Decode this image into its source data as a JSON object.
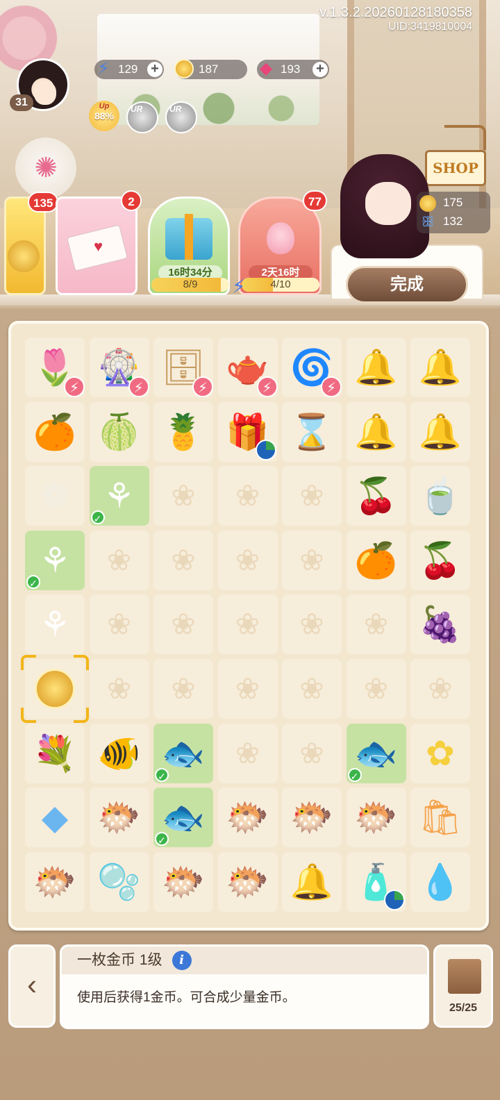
{
  "header": {
    "version": "v.1.3.2.20260128180358",
    "uid": "UID:3419810004",
    "level": "31"
  },
  "resources": {
    "energy": "129",
    "coins": "187",
    "gems": "193"
  },
  "badges": {
    "up_label": "Up",
    "up_percent": "88%",
    "ur_1": "UR",
    "ur_2": "UR"
  },
  "cards": {
    "gold_badge": "135",
    "mail_badge": "2",
    "gift_time": "16时34分",
    "gift_progress": "8/9",
    "gift_progress_fraction": 0.889,
    "peach_badge": "77",
    "peach_time": "2天16时",
    "peach_progress": "4/10",
    "peach_progress_fraction": 0.4
  },
  "shop": {
    "sign": "SHOP",
    "coins": "175",
    "butterflies": "132",
    "done_button": "完成"
  },
  "board": {
    "rows": [
      [
        "flower-planter-icon",
        "mill-garden-icon",
        "shelf-icon",
        "teapot-icon",
        "galaxy-orb-icon",
        "dome-white-flower-icon",
        "dome-lavender-icon"
      ],
      [
        "orange-fruit-icon",
        "green-fruit-icon",
        "pineapple-icon",
        "gift-box-icon",
        "hourglass-icon",
        "dome-purple-star-icon",
        "dome-purple-star-icon"
      ],
      [
        "gardenia-icon",
        "lily-icon",
        "",
        "",
        "",
        "berry-branch-icon",
        "tea-cup-icon"
      ],
      [
        "lily-icon",
        "",
        "",
        "",
        "",
        "kumquat-icon",
        "cherry-icon"
      ],
      [
        "calla-lily-icon",
        "",
        "",
        "",
        "",
        "",
        "green-grapes-icon"
      ],
      [
        "gold-coin-icon",
        "",
        "",
        "",
        "",
        "",
        ""
      ],
      [
        "calla-bouquet-icon",
        "betta-fish-icon",
        "clownfish-icon",
        "",
        "",
        "clownfish-icon",
        "yellow-flower-icon"
      ],
      [
        "blue-crystal-icon",
        "goldfish-icon",
        "clownfish-icon",
        "goldfish-icon",
        "goldfish-icon",
        "goldfish-icon",
        "orange-bag-icon"
      ],
      [
        "goldfish-icon",
        "fishbowl-icon",
        "goldfish-icon",
        "goldfish-icon",
        "dome-vanilla-icon",
        "perfume-bottle-icon",
        "pink-slime-icon"
      ]
    ],
    "green_cells": [
      [
        2,
        1
      ],
      [
        3,
        0
      ],
      [
        6,
        2
      ],
      [
        6,
        5
      ],
      [
        7,
        2
      ]
    ],
    "bolt_cells": [
      [
        0,
        0
      ],
      [
        0,
        1
      ],
      [
        0,
        2
      ],
      [
        0,
        3
      ],
      [
        0,
        4
      ]
    ],
    "timer_cells": [
      [
        1,
        3
      ],
      [
        8,
        5
      ]
    ],
    "selected_cell": [
      5,
      0
    ]
  },
  "info": {
    "title": "一枚金币 1级",
    "description": "使用后获得1金币。可合成少量金币。",
    "inventory": "25/25"
  }
}
